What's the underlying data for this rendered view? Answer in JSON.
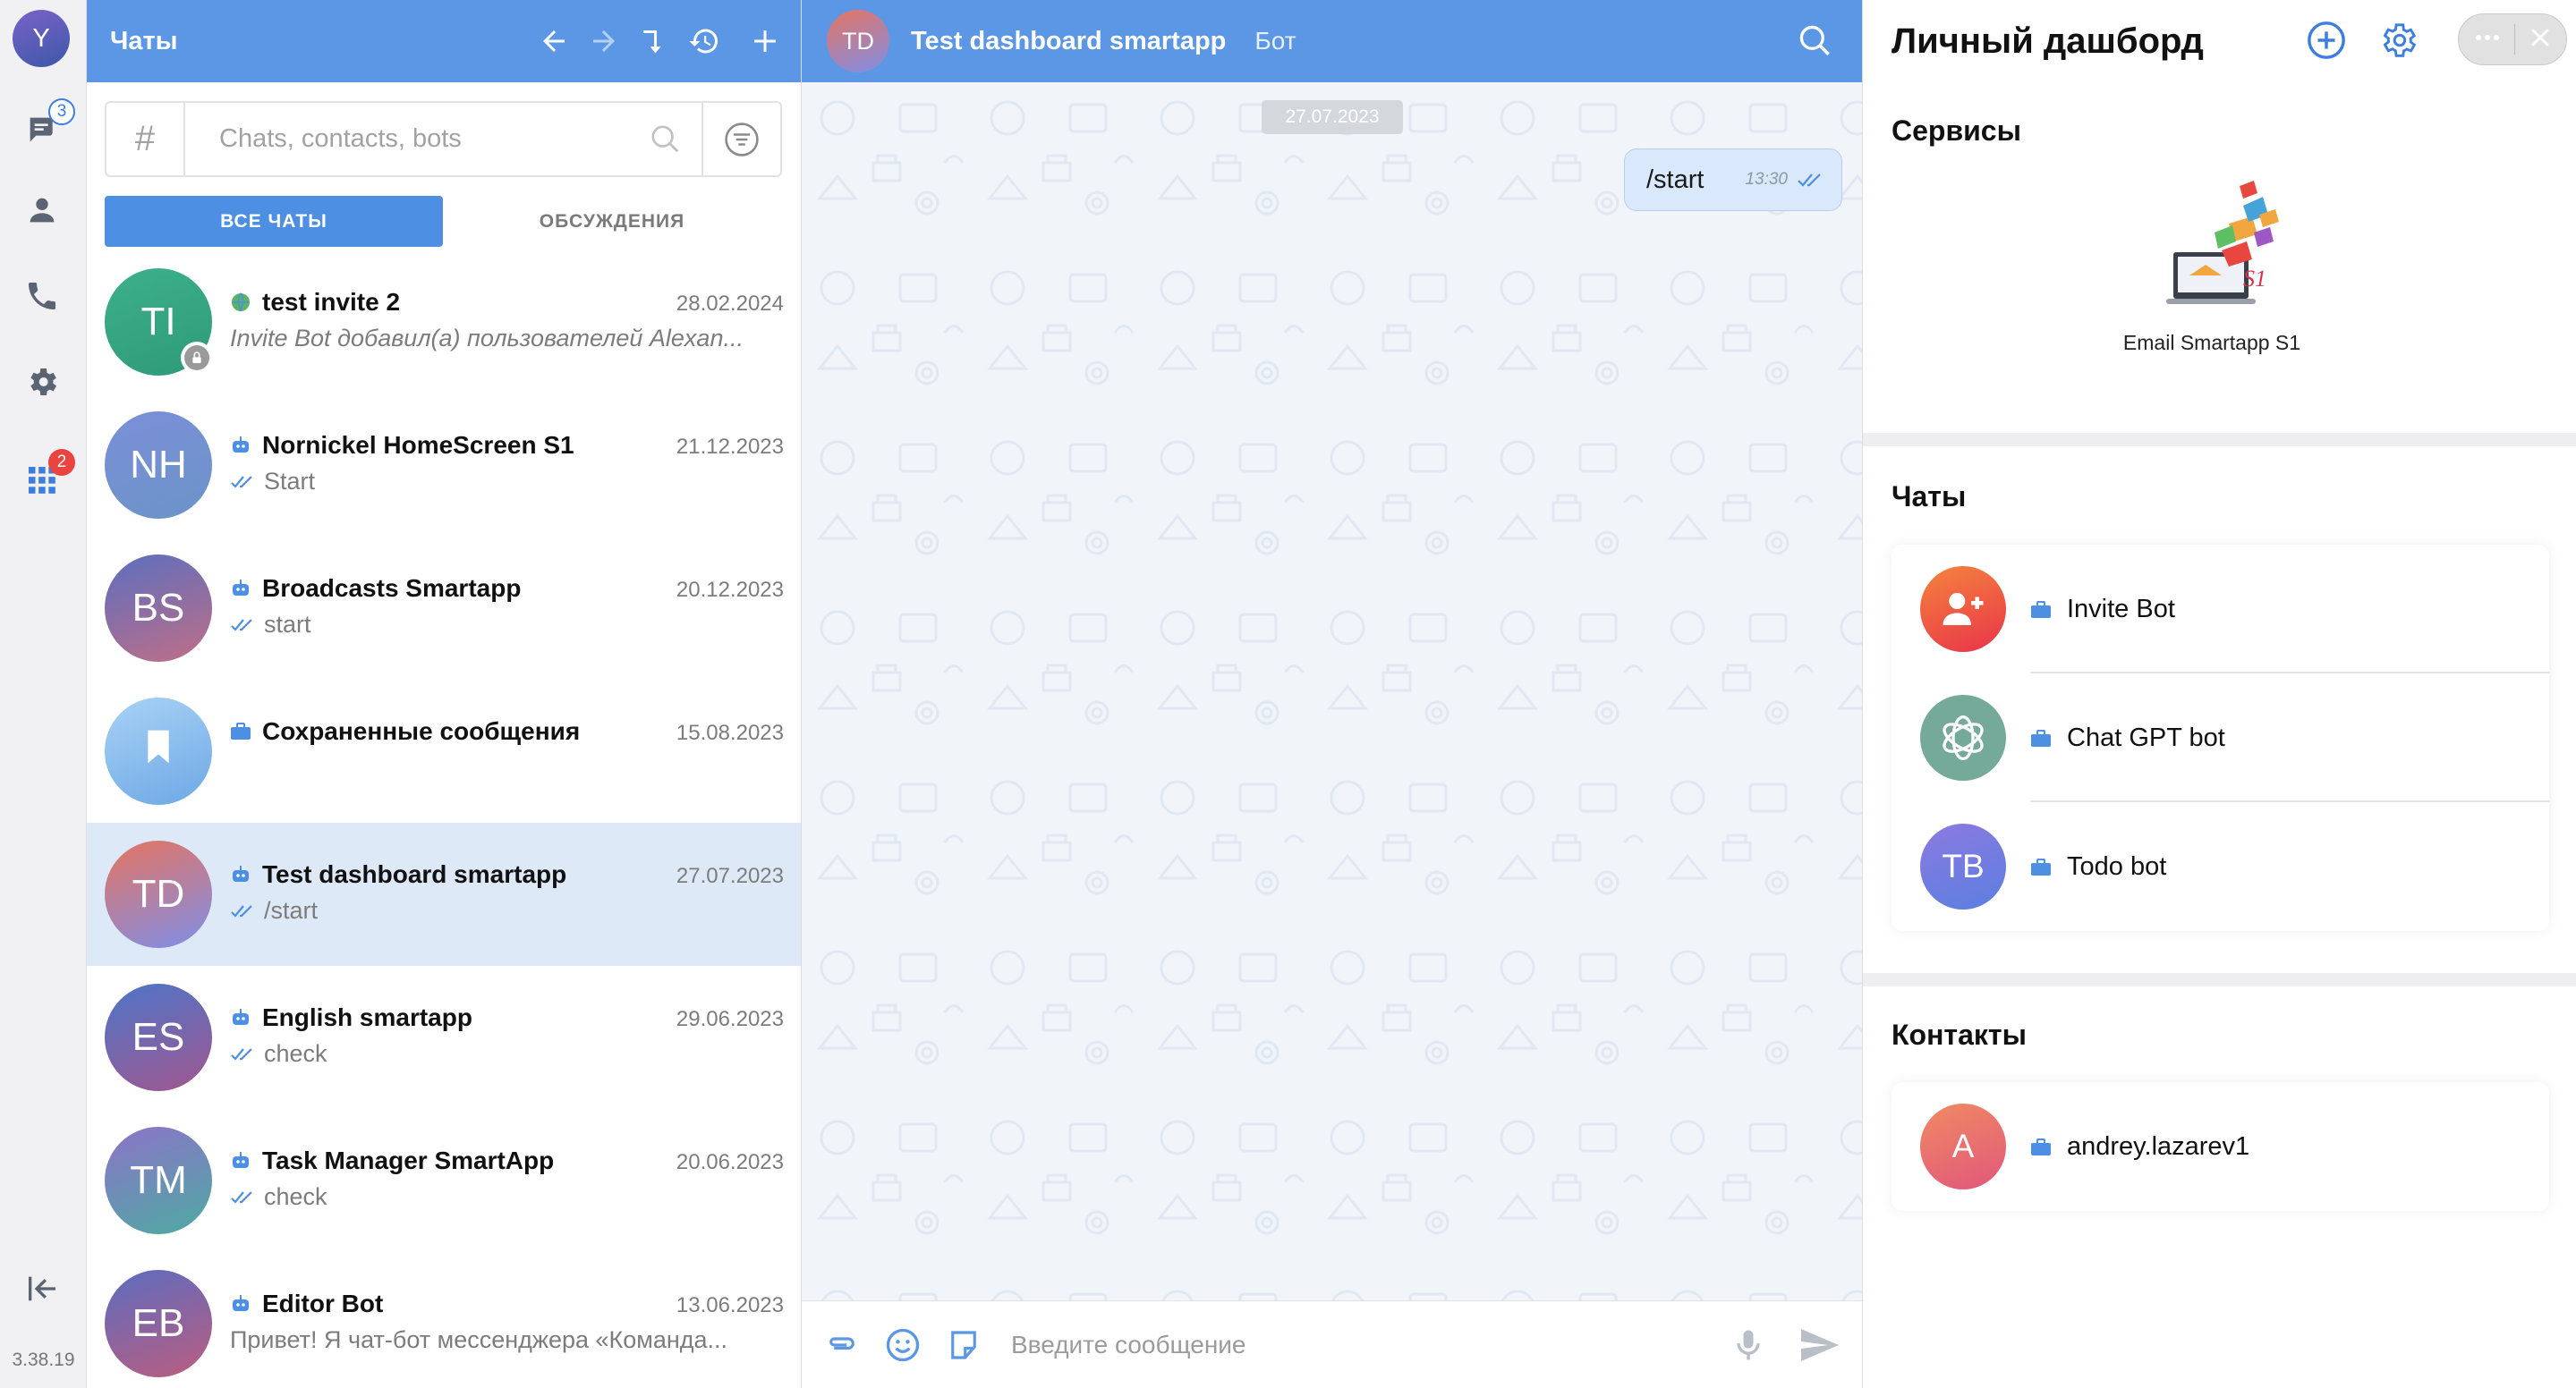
{
  "rail": {
    "user_initial": "Y",
    "chats_badge": "3",
    "apps_badge": "2",
    "version": "3.38.19"
  },
  "chat_list": {
    "title": "Чаты",
    "search_hash": "#",
    "search_placeholder": "Chats, contacts, bots",
    "tabs": [
      {
        "label": "ВСЕ ЧАТЫ",
        "active": true
      },
      {
        "label": "ОБСУЖДЕНИЯ",
        "active": false
      }
    ],
    "items": [
      {
        "initials": "TI",
        "name": "test invite 2",
        "date": "28.02.2024",
        "preview": "Invite Bot добавил(а) пользователей Alexan...",
        "tag": "globe",
        "ticks": false,
        "italic": true,
        "lock": true,
        "selected": false,
        "color": "#3aaa85"
      },
      {
        "initials": "NH",
        "name": "Nornickel HomeScreen S1",
        "date": "21.12.2023",
        "preview": "Start",
        "tag": "bot",
        "ticks": true,
        "italic": false,
        "lock": false,
        "selected": false,
        "color": "#6a8fd4"
      },
      {
        "initials": "BS",
        "name": "Broadcasts Smartapp",
        "date": "20.12.2023",
        "preview": "start",
        "tag": "bot",
        "ticks": true,
        "italic": false,
        "lock": false,
        "selected": false,
        "color": "#7f6ba7"
      },
      {
        "initials": "",
        "name": "Сохраненные сообщения",
        "date": "15.08.2023",
        "preview": "",
        "tag": "briefcase",
        "ticks": false,
        "italic": false,
        "lock": false,
        "selected": false,
        "color": "#7db4ea"
      },
      {
        "initials": "TD",
        "name": "Test dashboard smartapp",
        "date": "27.07.2023",
        "preview": "/start",
        "tag": "bot",
        "ticks": true,
        "italic": false,
        "lock": false,
        "selected": true,
        "color": "#d77b75"
      },
      {
        "initials": "ES",
        "name": "English smartapp",
        "date": "29.06.2023",
        "preview": "check",
        "tag": "bot",
        "ticks": true,
        "italic": false,
        "lock": false,
        "selected": false,
        "color": "#5d7bc0"
      },
      {
        "initials": "TM",
        "name": "Task Manager SmartApp",
        "date": "20.06.2023",
        "preview": "check",
        "tag": "bot",
        "ticks": true,
        "italic": false,
        "lock": false,
        "selected": false,
        "color": "#6a8ac7"
      },
      {
        "initials": "EB",
        "name": "Editor Bot",
        "date": "13.06.2023",
        "preview": "Привет! Я чат-бот мессенджера «Команда...",
        "tag": "bot",
        "ticks": false,
        "italic": false,
        "lock": false,
        "selected": false,
        "color": "#6a6fb4"
      }
    ]
  },
  "conversation": {
    "avatar_initials": "TD",
    "title": "Test dashboard smartapp",
    "subtitle": "Бот",
    "date_pill": "27.07.2023",
    "message": {
      "text": "/start",
      "time": "13:30"
    },
    "composer_placeholder": "Введите сообщение"
  },
  "dashboard": {
    "title": "Личный дашборд",
    "services_title": "Сервисы",
    "service_label": "Email Smartapp S1",
    "chats_title": "Чаты",
    "chats": [
      {
        "label": "Invite Bot",
        "avatar": "person-add"
      },
      {
        "label": "Chat GPT bot",
        "avatar": "openai"
      },
      {
        "label": "Todo bot",
        "avatar": "TB"
      }
    ],
    "contacts_title": "Контакты",
    "contacts": [
      {
        "label": "andrey.lazarev1",
        "avatar": "A"
      }
    ]
  },
  "colors": {
    "header_blue": "#5b97e4",
    "accent_blue": "#4d8fe2",
    "selected_row": "#dde9f7",
    "badge_red": "#e9443d"
  }
}
